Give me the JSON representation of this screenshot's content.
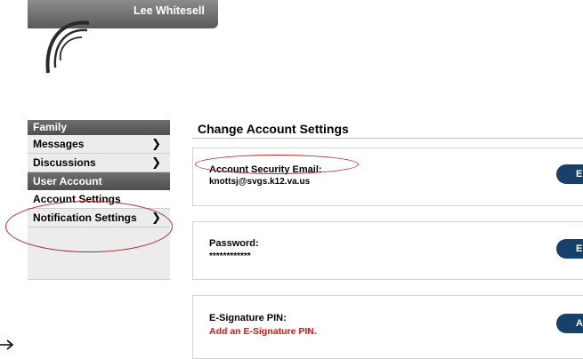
{
  "header": {
    "user_name": "Lee Whitesell"
  },
  "sidebar": {
    "sections": [
      {
        "title": "Family",
        "items": [
          {
            "label": "Messages"
          },
          {
            "label": "Discussions"
          }
        ]
      },
      {
        "title": "User Account",
        "items": [
          {
            "label": "Account Settings"
          },
          {
            "label": "Notification Settings"
          }
        ]
      }
    ]
  },
  "main": {
    "title": "Change Account Settings",
    "cards": [
      {
        "label": "Account Security Email:",
        "value": "knottsj@svgs.k12.va.us",
        "button": "E"
      },
      {
        "label": "Password:",
        "value": "************",
        "button": "E"
      },
      {
        "label": "E-Signature PIN:",
        "value": "Add an E-Signature PIN.",
        "button": "A"
      }
    ]
  },
  "colors": {
    "header_bar": "#6b6b6b",
    "sidebar_head": "#5a5a5a",
    "button": "#17416a",
    "annotation": "#b5272b",
    "warning_text": "#e01010"
  },
  "icons": [
    "logo-swirl-icon",
    "chevron-right-icon",
    "arrow-icon"
  ]
}
